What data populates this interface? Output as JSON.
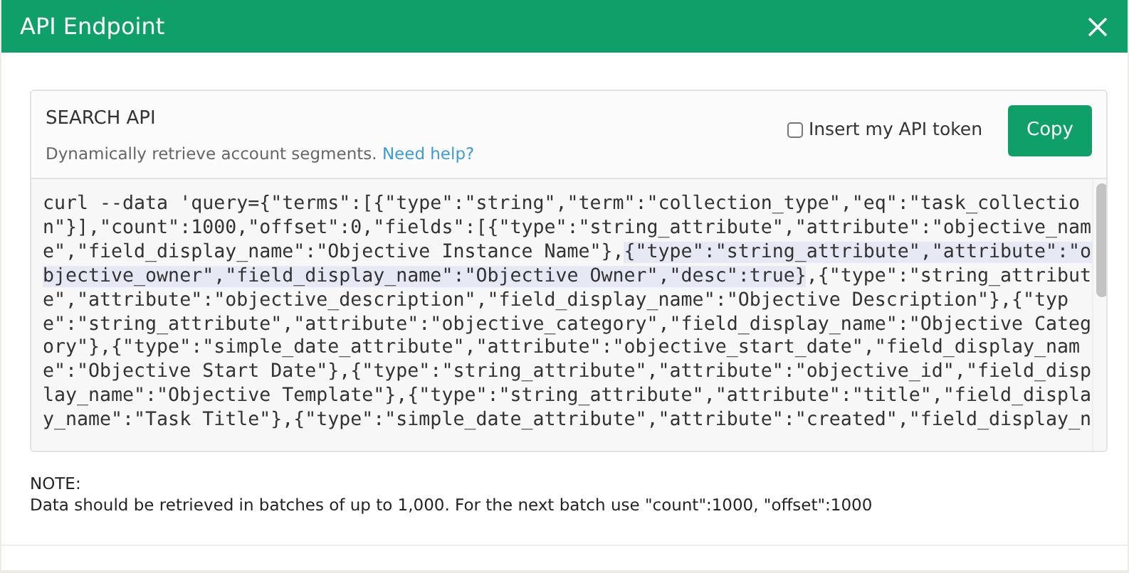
{
  "window": {
    "title": "API Endpoint"
  },
  "panel": {
    "title": "SEARCH API",
    "subtitle": "Dynamically retrieve account segments.",
    "help_link": "Need help?",
    "token_checkbox": {
      "label": "Insert my API token",
      "checked": false
    },
    "copy_button": "Copy"
  },
  "code_lines": [
    [
      {
        "text": "curl --data 'query={\"terms\":[{\"type\":\"string\",\"term\":\"collection_type\",\"eq\":\"task_collectio",
        "highlighted": false
      }
    ],
    [
      {
        "text": "n\"}],\"count\":1000,\"offset\":0,\"fields\":[{\"type\":\"string_attribute\",\"attribute\":\"objective_nam",
        "highlighted": false
      }
    ],
    [
      {
        "text": "e\",\"field_display_name\":\"Objective Instance Name\"},",
        "highlighted": false
      },
      {
        "text": "{\"type\":\"string_attribute\",\"attribute\":\"o",
        "highlighted": true
      }
    ],
    [
      {
        "text": "bjective_owner\",\"field_display_name\":\"Objective Owner\",\"desc\":true}",
        "highlighted": true
      },
      {
        "text": ",{\"type\":\"string_attribut",
        "highlighted": false
      }
    ],
    [
      {
        "text": "e\",\"attribute\":\"objective_description\",\"field_display_name\":\"Objective Description\"},{\"typ",
        "highlighted": false
      }
    ],
    [
      {
        "text": "e\":\"string_attribute\",\"attribute\":\"objective_category\",\"field_display_name\":\"Objective Categ",
        "highlighted": false
      }
    ],
    [
      {
        "text": "ory\"},{\"type\":\"simple_date_attribute\",\"attribute\":\"objective_start_date\",\"field_display_nam",
        "highlighted": false
      }
    ],
    [
      {
        "text": "e\":\"Objective Start Date\"},{\"type\":\"string_attribute\",\"attribute\":\"objective_id\",\"field_disp",
        "highlighted": false
      }
    ],
    [
      {
        "text": "lay_name\":\"Objective Template\"},{\"type\":\"string_attribute\",\"attribute\":\"title\",\"field_displa",
        "highlighted": false
      }
    ],
    [
      {
        "text": "y_name\":\"Task Title\"},{\"type\":\"simple_date_attribute\",\"attribute\":\"created\",\"field_display_n",
        "highlighted": false
      }
    ]
  ],
  "note": {
    "heading": "NOTE:",
    "text": "Data should be retrieved in batches of up to 1,000. For the next batch use \"count\":1000, \"offset\":1000"
  }
}
